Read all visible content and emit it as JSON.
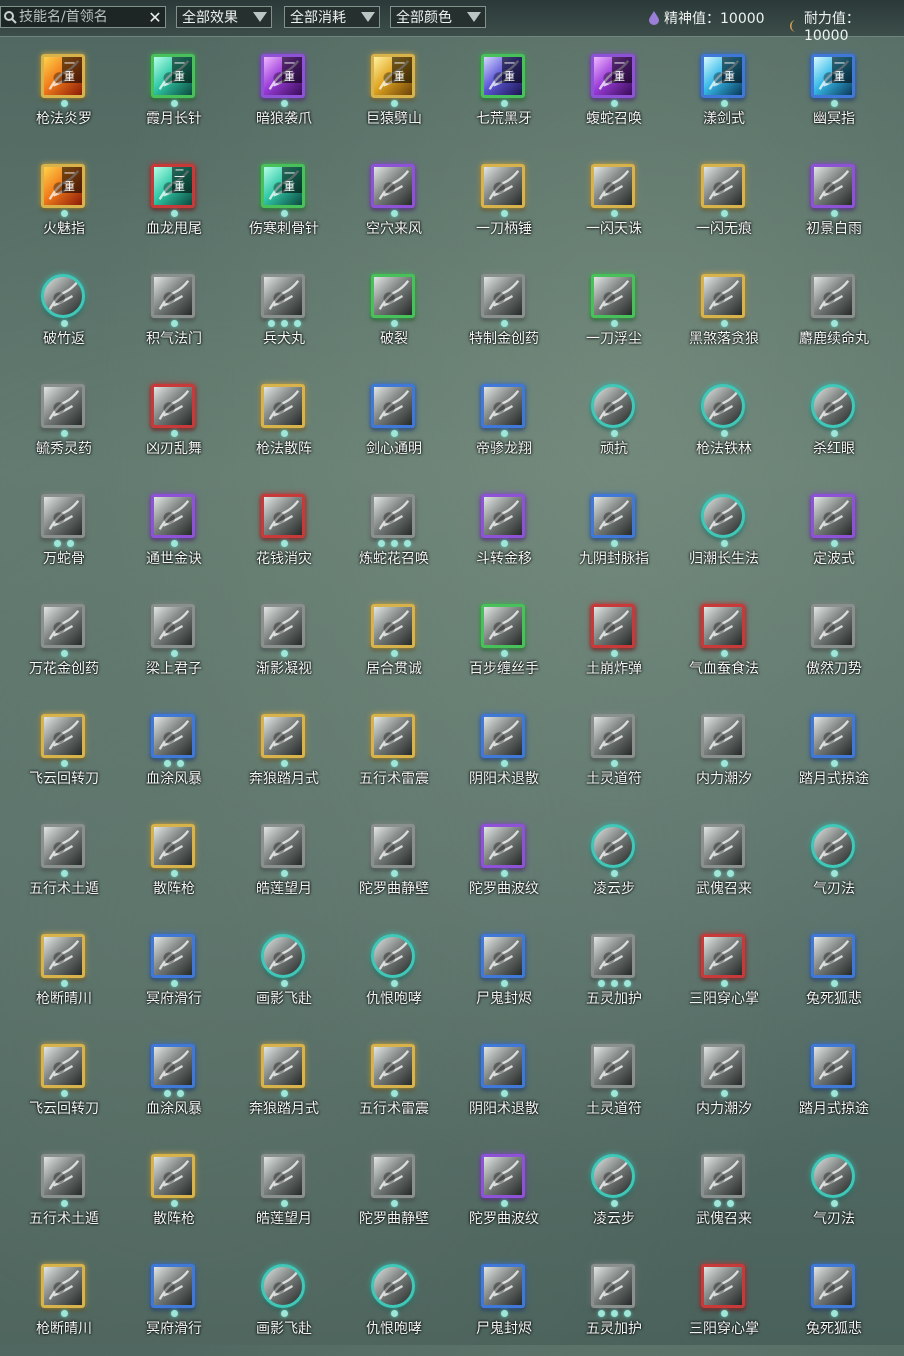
{
  "toolbar": {
    "search_placeholder": "技能名/首领名",
    "filter_effect": "全部效果",
    "filter_cost": "全部消耗",
    "filter_color": "全部颜色",
    "spirit": "精神值：10000",
    "endurance": "耐力值：10000"
  },
  "colors": {
    "gold": "#d8b24a",
    "green": "#49c15a",
    "purple": "#8e52d6",
    "blue": "#3f78d6",
    "red": "#c83a3a",
    "teal": "#3fc8b8",
    "gray": "#8a908e"
  },
  "skills": [
    {
      "name": "枪法炎罗",
      "frame": "gold",
      "badge": "一重",
      "dots": 1,
      "round": false,
      "art": "fire"
    },
    {
      "name": "霞月长针",
      "frame": "green",
      "badge": "一重",
      "dots": 1,
      "round": false,
      "art": "teal"
    },
    {
      "name": "暗狼袭爪",
      "frame": "purple",
      "badge": "一重",
      "dots": 1,
      "round": false,
      "art": "violet"
    },
    {
      "name": "巨猿劈山",
      "frame": "gold",
      "badge": "一重",
      "dots": 1,
      "round": false,
      "art": "yellow"
    },
    {
      "name": "七荒黑牙",
      "frame": "green",
      "badge": "一重",
      "dots": 1,
      "round": false,
      "art": "indigo"
    },
    {
      "name": "蝮蛇召唤",
      "frame": "purple",
      "badge": "一重",
      "dots": 1,
      "round": false,
      "art": "violet"
    },
    {
      "name": "漾剑式",
      "frame": "blue",
      "badge": "一重",
      "dots": 1,
      "round": false,
      "art": "cyan"
    },
    {
      "name": "幽冥指",
      "frame": "blue",
      "badge": "一重",
      "dots": 1,
      "round": false,
      "art": "cyan"
    },
    {
      "name": "火魅指",
      "frame": "gold",
      "badge": "一重",
      "dots": 1,
      "round": false,
      "art": "fire"
    },
    {
      "name": "血龙甩尾",
      "frame": "red",
      "badge": "二重",
      "dots": 1,
      "round": false,
      "art": "teal"
    },
    {
      "name": "伤寒刺骨针",
      "frame": "green",
      "badge": "一重",
      "dots": 1,
      "round": false,
      "art": "teal"
    },
    {
      "name": "空穴来风",
      "frame": "purple",
      "badge": "",
      "dots": 1,
      "round": false,
      "art": "gray"
    },
    {
      "name": "一刀柄锤",
      "frame": "gold",
      "badge": "",
      "dots": 1,
      "round": false,
      "art": "gray"
    },
    {
      "name": "一闪天诛",
      "frame": "gold",
      "badge": "",
      "dots": 1,
      "round": false,
      "art": "gray"
    },
    {
      "name": "一闪无痕",
      "frame": "gold",
      "badge": "",
      "dots": 1,
      "round": false,
      "art": "gray"
    },
    {
      "name": "初景白雨",
      "frame": "purple",
      "badge": "",
      "dots": 1,
      "round": false,
      "art": "gray"
    },
    {
      "name": "破竹返",
      "frame": "teal",
      "badge": "",
      "dots": 1,
      "round": true,
      "art": "gray"
    },
    {
      "name": "积气法门",
      "frame": "gray",
      "badge": "",
      "dots": 1,
      "round": false,
      "art": "gray"
    },
    {
      "name": "兵犬丸",
      "frame": "gray",
      "badge": "",
      "dots": 3,
      "round": false,
      "art": "gray"
    },
    {
      "name": "破裂",
      "frame": "green",
      "badge": "",
      "dots": 1,
      "round": false,
      "art": "gray"
    },
    {
      "name": "特制金创药",
      "frame": "gray",
      "badge": "",
      "dots": 1,
      "round": false,
      "art": "gray"
    },
    {
      "name": "一刀浮尘",
      "frame": "green",
      "badge": "",
      "dots": 1,
      "round": false,
      "art": "gray"
    },
    {
      "name": "黑煞落贪狼",
      "frame": "gold",
      "badge": "",
      "dots": 1,
      "round": false,
      "art": "gray"
    },
    {
      "name": "麝鹿续命丸",
      "frame": "gray",
      "badge": "",
      "dots": 1,
      "round": false,
      "art": "gray"
    },
    {
      "name": "毓秀灵药",
      "frame": "gray",
      "badge": "",
      "dots": 1,
      "round": false,
      "art": "gray"
    },
    {
      "name": "凶刃乱舞",
      "frame": "red",
      "badge": "",
      "dots": 1,
      "round": false,
      "art": "gray"
    },
    {
      "name": "枪法散阵",
      "frame": "gold",
      "badge": "",
      "dots": 1,
      "round": false,
      "art": "gray"
    },
    {
      "name": "剑心通明",
      "frame": "blue",
      "badge": "",
      "dots": 1,
      "round": false,
      "art": "gray"
    },
    {
      "name": "帝骖龙翔",
      "frame": "blue",
      "badge": "",
      "dots": 1,
      "round": false,
      "art": "gray"
    },
    {
      "name": "顽抗",
      "frame": "teal",
      "badge": "",
      "dots": 1,
      "round": true,
      "art": "gray"
    },
    {
      "name": "枪法铁林",
      "frame": "teal",
      "badge": "",
      "dots": 1,
      "round": true,
      "art": "gray"
    },
    {
      "name": "杀红眼",
      "frame": "teal",
      "badge": "",
      "dots": 1,
      "round": true,
      "art": "gray"
    },
    {
      "name": "万蛇骨",
      "frame": "gray",
      "badge": "",
      "dots": 2,
      "round": false,
      "art": "gray"
    },
    {
      "name": "通世金诀",
      "frame": "purple",
      "badge": "",
      "dots": 1,
      "round": false,
      "art": "gray"
    },
    {
      "name": "花钱消灾",
      "frame": "red",
      "badge": "",
      "dots": 1,
      "round": false,
      "art": "gray"
    },
    {
      "name": "炼蛇花召唤",
      "frame": "gray",
      "badge": "",
      "dots": 3,
      "round": false,
      "art": "gray"
    },
    {
      "name": "斗转金移",
      "frame": "purple",
      "badge": "",
      "dots": 1,
      "round": false,
      "art": "gray"
    },
    {
      "name": "九阴封脉指",
      "frame": "blue",
      "badge": "",
      "dots": 1,
      "round": false,
      "art": "gray"
    },
    {
      "name": "归潮长生法",
      "frame": "teal",
      "badge": "",
      "dots": 1,
      "round": true,
      "art": "gray"
    },
    {
      "name": "定波式",
      "frame": "purple",
      "badge": "",
      "dots": 1,
      "round": false,
      "art": "gray"
    },
    {
      "name": "万花金创药",
      "frame": "gray",
      "badge": "",
      "dots": 1,
      "round": false,
      "art": "gray"
    },
    {
      "name": "梁上君子",
      "frame": "gray",
      "badge": "",
      "dots": 1,
      "round": false,
      "art": "gray"
    },
    {
      "name": "渐影凝视",
      "frame": "gray",
      "badge": "",
      "dots": 1,
      "round": false,
      "art": "gray"
    },
    {
      "name": "居合贯诚",
      "frame": "gold",
      "badge": "",
      "dots": 1,
      "round": false,
      "art": "gray"
    },
    {
      "name": "百步缠丝手",
      "frame": "green",
      "badge": "",
      "dots": 1,
      "round": false,
      "art": "gray"
    },
    {
      "name": "土崩炸弹",
      "frame": "red",
      "badge": "",
      "dots": 1,
      "round": false,
      "art": "gray"
    },
    {
      "name": "气血蚕食法",
      "frame": "red",
      "badge": "",
      "dots": 1,
      "round": false,
      "art": "gray"
    },
    {
      "name": "傲然刀势",
      "frame": "gray",
      "badge": "",
      "dots": 1,
      "round": false,
      "art": "gray"
    },
    {
      "name": "飞云回转刀",
      "frame": "gold",
      "badge": "",
      "dots": 1,
      "round": false,
      "art": "gray"
    },
    {
      "name": "血涂风暴",
      "frame": "blue",
      "badge": "",
      "dots": 2,
      "round": false,
      "art": "gray"
    },
    {
      "name": "奔狼踏月式",
      "frame": "gold",
      "badge": "",
      "dots": 1,
      "round": false,
      "art": "gray"
    },
    {
      "name": "五行术雷震",
      "frame": "gold",
      "badge": "",
      "dots": 1,
      "round": false,
      "art": "gray"
    },
    {
      "name": "阴阳术退散",
      "frame": "blue",
      "badge": "",
      "dots": 1,
      "round": false,
      "art": "gray"
    },
    {
      "name": "土灵道符",
      "frame": "gray",
      "badge": "",
      "dots": 1,
      "round": false,
      "art": "gray"
    },
    {
      "name": "内力潮汐",
      "frame": "gray",
      "badge": "",
      "dots": 1,
      "round": false,
      "art": "gray"
    },
    {
      "name": "踏月式掠途",
      "frame": "blue",
      "badge": "",
      "dots": 1,
      "round": false,
      "art": "gray"
    },
    {
      "name": "五行术土遁",
      "frame": "gray",
      "badge": "",
      "dots": 1,
      "round": false,
      "art": "gray"
    },
    {
      "name": "散阵枪",
      "frame": "gold",
      "badge": "",
      "dots": 1,
      "round": false,
      "art": "gray"
    },
    {
      "name": "皓莲望月",
      "frame": "gray",
      "badge": "",
      "dots": 1,
      "round": false,
      "art": "gray"
    },
    {
      "name": "陀罗曲静壁",
      "frame": "gray",
      "badge": "",
      "dots": 1,
      "round": false,
      "art": "gray"
    },
    {
      "name": "陀罗曲波纹",
      "frame": "purple",
      "badge": "",
      "dots": 1,
      "round": false,
      "art": "gray"
    },
    {
      "name": "凌云步",
      "frame": "teal",
      "badge": "",
      "dots": 1,
      "round": true,
      "art": "gray"
    },
    {
      "name": "武傀召来",
      "frame": "gray",
      "badge": "",
      "dots": 2,
      "round": false,
      "art": "gray"
    },
    {
      "name": "气刃法",
      "frame": "teal",
      "badge": "",
      "dots": 1,
      "round": true,
      "art": "gray"
    },
    {
      "name": "枪断晴川",
      "frame": "gold",
      "badge": "",
      "dots": 1,
      "round": false,
      "art": "gray"
    },
    {
      "name": "冥府滑行",
      "frame": "blue",
      "badge": "",
      "dots": 1,
      "round": false,
      "art": "gray"
    },
    {
      "name": "画影飞赴",
      "frame": "teal",
      "badge": "",
      "dots": 1,
      "round": true,
      "art": "gray"
    },
    {
      "name": "仇恨咆哮",
      "frame": "teal",
      "badge": "",
      "dots": 1,
      "round": true,
      "art": "gray"
    },
    {
      "name": "尸鬼封烬",
      "frame": "blue",
      "badge": "",
      "dots": 1,
      "round": false,
      "art": "gray"
    },
    {
      "name": "五灵加护",
      "frame": "gray",
      "badge": "",
      "dots": 3,
      "round": false,
      "art": "gray"
    },
    {
      "name": "三阳穿心掌",
      "frame": "red",
      "badge": "",
      "dots": 1,
      "round": false,
      "art": "gray"
    },
    {
      "name": "兔死狐悲",
      "frame": "blue",
      "badge": "",
      "dots": 1,
      "round": false,
      "art": "gray"
    },
    {
      "name": "飞云回转刀",
      "frame": "gold",
      "badge": "",
      "dots": 1,
      "round": false,
      "art": "gray"
    },
    {
      "name": "血涂风暴",
      "frame": "blue",
      "badge": "",
      "dots": 2,
      "round": false,
      "art": "gray"
    },
    {
      "name": "奔狼踏月式",
      "frame": "gold",
      "badge": "",
      "dots": 1,
      "round": false,
      "art": "gray"
    },
    {
      "name": "五行术雷震",
      "frame": "gold",
      "badge": "",
      "dots": 1,
      "round": false,
      "art": "gray"
    },
    {
      "name": "阴阳术退散",
      "frame": "blue",
      "badge": "",
      "dots": 1,
      "round": false,
      "art": "gray"
    },
    {
      "name": "土灵道符",
      "frame": "gray",
      "badge": "",
      "dots": 1,
      "round": false,
      "art": "gray"
    },
    {
      "name": "内力潮汐",
      "frame": "gray",
      "badge": "",
      "dots": 1,
      "round": false,
      "art": "gray"
    },
    {
      "name": "踏月式掠途",
      "frame": "blue",
      "badge": "",
      "dots": 1,
      "round": false,
      "art": "gray"
    },
    {
      "name": "五行术土遁",
      "frame": "gray",
      "badge": "",
      "dots": 1,
      "round": false,
      "art": "gray"
    },
    {
      "name": "散阵枪",
      "frame": "gold",
      "badge": "",
      "dots": 1,
      "round": false,
      "art": "gray"
    },
    {
      "name": "皓莲望月",
      "frame": "gray",
      "badge": "",
      "dots": 1,
      "round": false,
      "art": "gray"
    },
    {
      "name": "陀罗曲静壁",
      "frame": "gray",
      "badge": "",
      "dots": 1,
      "round": false,
      "art": "gray"
    },
    {
      "name": "陀罗曲波纹",
      "frame": "purple",
      "badge": "",
      "dots": 1,
      "round": false,
      "art": "gray"
    },
    {
      "name": "凌云步",
      "frame": "teal",
      "badge": "",
      "dots": 1,
      "round": true,
      "art": "gray"
    },
    {
      "name": "武傀召来",
      "frame": "gray",
      "badge": "",
      "dots": 2,
      "round": false,
      "art": "gray"
    },
    {
      "name": "气刃法",
      "frame": "teal",
      "badge": "",
      "dots": 1,
      "round": true,
      "art": "gray"
    },
    {
      "name": "枪断晴川",
      "frame": "gold",
      "badge": "",
      "dots": 1,
      "round": false,
      "art": "gray"
    },
    {
      "name": "冥府滑行",
      "frame": "blue",
      "badge": "",
      "dots": 1,
      "round": false,
      "art": "gray"
    },
    {
      "name": "画影飞赴",
      "frame": "teal",
      "badge": "",
      "dots": 1,
      "round": true,
      "art": "gray"
    },
    {
      "name": "仇恨咆哮",
      "frame": "teal",
      "badge": "",
      "dots": 1,
      "round": true,
      "art": "gray"
    },
    {
      "name": "尸鬼封烬",
      "frame": "blue",
      "badge": "",
      "dots": 1,
      "round": false,
      "art": "gray"
    },
    {
      "name": "五灵加护",
      "frame": "gray",
      "badge": "",
      "dots": 3,
      "round": false,
      "art": "gray"
    },
    {
      "name": "三阳穿心掌",
      "frame": "red",
      "badge": "",
      "dots": 1,
      "round": false,
      "art": "gray"
    },
    {
      "name": "兔死狐悲",
      "frame": "blue",
      "badge": "",
      "dots": 1,
      "round": false,
      "art": "gray"
    }
  ]
}
